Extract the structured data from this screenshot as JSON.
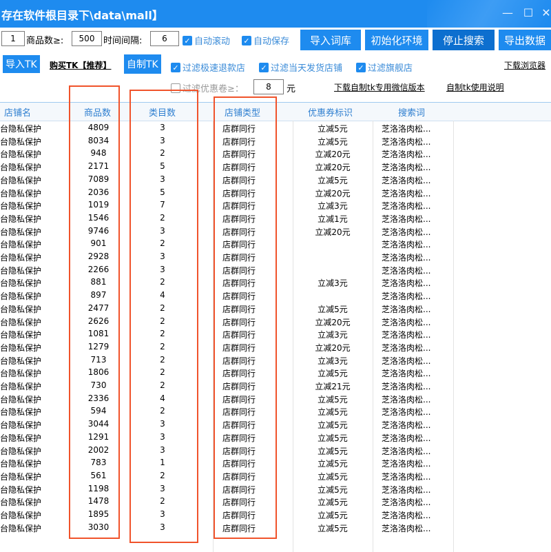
{
  "window": {
    "title": "存在软件根目录下\\data\\mall】",
    "minimize_glyph": "—",
    "maximize_glyph": "☐",
    "close_glyph": "✕"
  },
  "toolbar1": {
    "first_value": "1",
    "goods_count_label": "商品数≥:",
    "goods_count_value": "500",
    "interval_label": "时间间隔:",
    "interval_value": "6",
    "auto_scroll_label": "自动滚动",
    "auto_save_label": "自动保存",
    "import_words_label": "导入词库",
    "init_env_label": "初始化环境",
    "stop_search_label": "停止搜索",
    "export_data_label": "导出数据"
  },
  "toolbar2": {
    "import_tk_label": "导入TK",
    "buy_tk_label": "购买TK【推荐】",
    "self_tk_label": "自制TK",
    "filter_refund_label": "过滤极速退款店",
    "filter_sameday_label": "过滤当天发货店铺",
    "filter_flagship_label": "过滤旗舰店",
    "download_browser_label": "下载浏览器"
  },
  "toolbar3": {
    "filter_coupon_label": "过滤优惠卷≥：",
    "filter_coupon_value": "8",
    "coupon_unit": "元",
    "download_wechat_label": "下载自制tk专用微信版本",
    "instructions_label": "自制tk使用说明"
  },
  "table": {
    "headers": [
      "店铺名",
      "商品数",
      "类目数",
      "店铺类型",
      "优惠券标识",
      "搜索词"
    ],
    "rows": [
      [
        "台隐私保护",
        "4809",
        "3",
        "店群同行",
        "立减5元",
        "芝洛洛肉松..."
      ],
      [
        "台隐私保护",
        "8034",
        "3",
        "店群同行",
        "立减5元",
        "芝洛洛肉松..."
      ],
      [
        "台隐私保护",
        "948",
        "2",
        "店群同行",
        "立减20元",
        "芝洛洛肉松..."
      ],
      [
        "台隐私保护",
        "2171",
        "5",
        "店群同行",
        "立减20元",
        "芝洛洛肉松..."
      ],
      [
        "台隐私保护",
        "7089",
        "3",
        "店群同行",
        "立减5元",
        "芝洛洛肉松..."
      ],
      [
        "台隐私保护",
        "2036",
        "5",
        "店群同行",
        "立减20元",
        "芝洛洛肉松..."
      ],
      [
        "台隐私保护",
        "1019",
        "7",
        "店群同行",
        "立减3元",
        "芝洛洛肉松..."
      ],
      [
        "台隐私保护",
        "1546",
        "2",
        "店群同行",
        "立减1元",
        "芝洛洛肉松..."
      ],
      [
        "台隐私保护",
        "9746",
        "3",
        "店群同行",
        "立减20元",
        "芝洛洛肉松..."
      ],
      [
        "台隐私保护",
        "901",
        "2",
        "店群同行",
        "",
        "芝洛洛肉松..."
      ],
      [
        "台隐私保护",
        "2928",
        "3",
        "店群同行",
        "",
        "芝洛洛肉松..."
      ],
      [
        "台隐私保护",
        "2266",
        "3",
        "店群同行",
        "",
        "芝洛洛肉松..."
      ],
      [
        "台隐私保护",
        "881",
        "2",
        "店群同行",
        "立减3元",
        "芝洛洛肉松..."
      ],
      [
        "台隐私保护",
        "897",
        "4",
        "店群同行",
        "",
        "芝洛洛肉松..."
      ],
      [
        "台隐私保护",
        "2477",
        "2",
        "店群同行",
        "立减5元",
        "芝洛洛肉松..."
      ],
      [
        "台隐私保护",
        "2626",
        "2",
        "店群同行",
        "立减20元",
        "芝洛洛肉松..."
      ],
      [
        "台隐私保护",
        "1081",
        "2",
        "店群同行",
        "立减3元",
        "芝洛洛肉松..."
      ],
      [
        "台隐私保护",
        "1279",
        "2",
        "店群同行",
        "立减20元",
        "芝洛洛肉松..."
      ],
      [
        "台隐私保护",
        "713",
        "2",
        "店群同行",
        "立减3元",
        "芝洛洛肉松..."
      ],
      [
        "台隐私保护",
        "1806",
        "2",
        "店群同行",
        "立减5元",
        "芝洛洛肉松..."
      ],
      [
        "台隐私保护",
        "730",
        "2",
        "店群同行",
        "立减21元",
        "芝洛洛肉松..."
      ],
      [
        "台隐私保护",
        "2336",
        "4",
        "店群同行",
        "立减5元",
        "芝洛洛肉松..."
      ],
      [
        "台隐私保护",
        "594",
        "2",
        "店群同行",
        "立减5元",
        "芝洛洛肉松..."
      ],
      [
        "台隐私保护",
        "3044",
        "3",
        "店群同行",
        "立减5元",
        "芝洛洛肉松..."
      ],
      [
        "台隐私保护",
        "1291",
        "3",
        "店群同行",
        "立减5元",
        "芝洛洛肉松..."
      ],
      [
        "台隐私保护",
        "2002",
        "3",
        "店群同行",
        "立减5元",
        "芝洛洛肉松..."
      ],
      [
        "台隐私保护",
        "783",
        "1",
        "店群同行",
        "立减5元",
        "芝洛洛肉松..."
      ],
      [
        "台隐私保护",
        "561",
        "2",
        "店群同行",
        "立减5元",
        "芝洛洛肉松..."
      ],
      [
        "台隐私保护",
        "1198",
        "3",
        "店群同行",
        "立减5元",
        "芝洛洛肉松..."
      ],
      [
        "台隐私保护",
        "1478",
        "2",
        "店群同行",
        "立减5元",
        "芝洛洛肉松..."
      ],
      [
        "台隐私保护",
        "1895",
        "3",
        "店群同行",
        "立减5元",
        "芝洛洛肉松..."
      ],
      [
        "台隐私保护",
        "3030",
        "3",
        "店群同行",
        "立减5元",
        "芝洛洛肉松..."
      ]
    ]
  },
  "colors": {
    "title_bar": "#1e8bef",
    "button": "#1e8bef",
    "button_dark": "#0d6fcf",
    "header_text": "#2f7fd0",
    "annotation": "#f0522a"
  }
}
